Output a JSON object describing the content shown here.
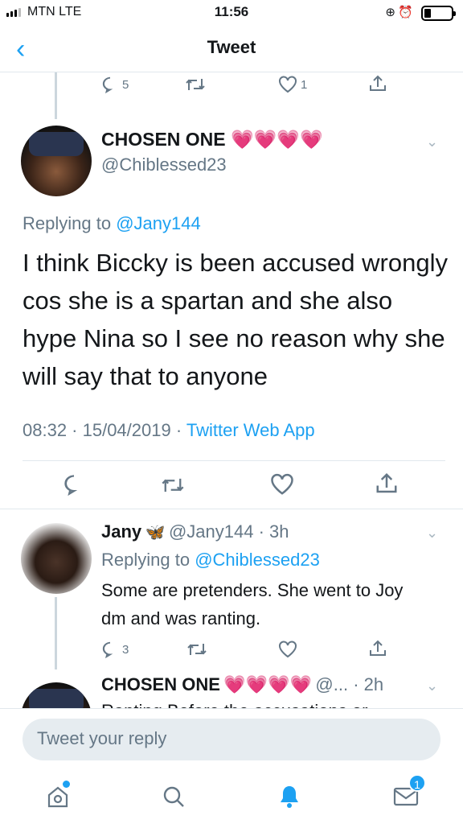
{
  "status": {
    "carrier": "MTN  LTE",
    "time": "11:56"
  },
  "nav": {
    "title": "Tweet"
  },
  "parent_actions": {
    "replies": "5",
    "likes": "1"
  },
  "main_tweet": {
    "name": "CHOSEN ONE",
    "emojis": "💗💗💗💗",
    "handle": "@Chiblessed23",
    "replying_prefix": "Replying to ",
    "replying_to": "@Jany144",
    "text": "I think Biccky is been accused wrongly cos she is a spartan and she also hype Nina so I see no reason why she will say that to anyone",
    "timestamp": "08:32 · 15/04/2019 · ",
    "source": "Twitter Web App"
  },
  "reply1": {
    "name": "Jany",
    "handle_time": "@Jany144 · 3h",
    "replying_prefix": "Replying to ",
    "replying_to": "@Chiblessed23",
    "text": "Some are pretenders. She went to Joy dm and was ranting.",
    "replies": "3"
  },
  "reply2": {
    "name": "CHOSEN ONE",
    "emojis": "💗💗💗💗",
    "handle_time": "@... · 2h",
    "partial_text": "Ranting Before the accusations or"
  },
  "compose": {
    "placeholder": "Tweet your reply"
  },
  "tabbar": {
    "messages_badge": "1"
  },
  "colors": {
    "accent": "#1da1f2",
    "muted": "#657786",
    "border": "#e1e8ed"
  }
}
